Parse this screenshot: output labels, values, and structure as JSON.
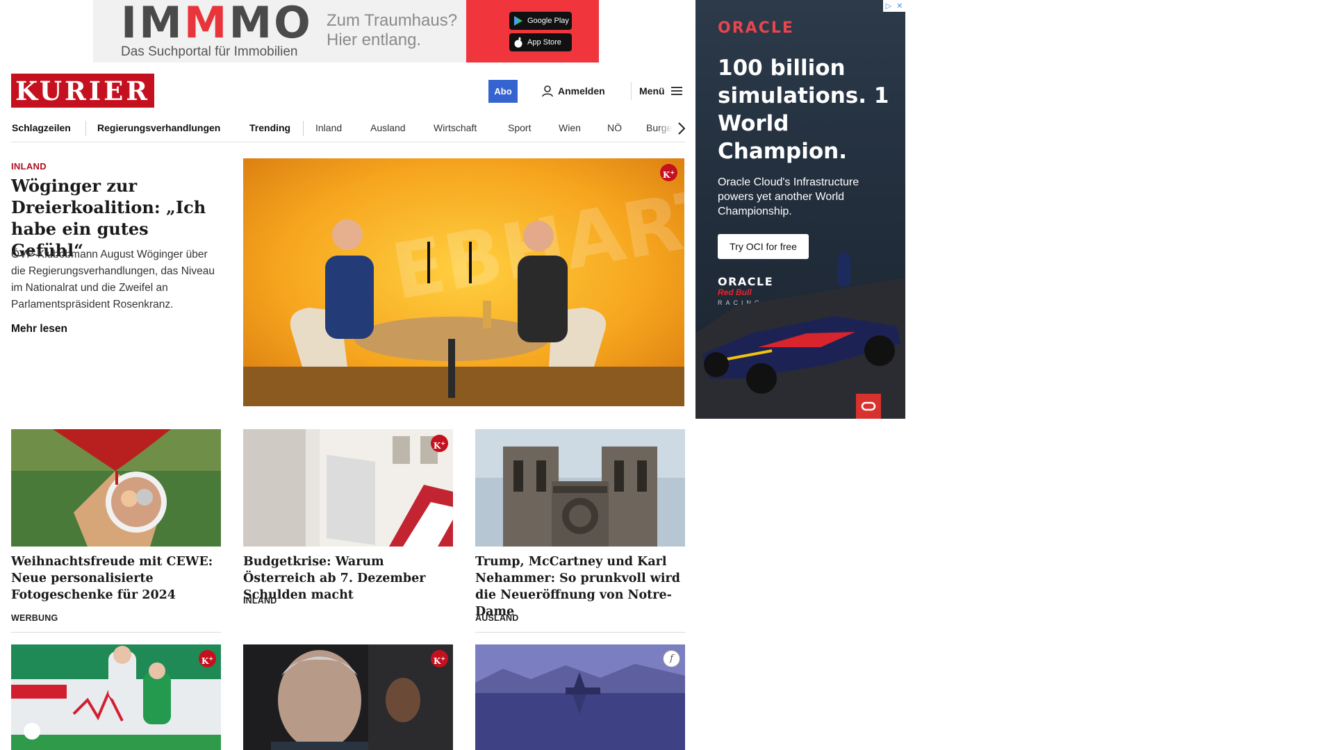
{
  "top_ad": {
    "brand_a": "IM",
    "brand_b": "M",
    "brand_c": "MO",
    "tagline": "Das Suchportal für Immobilien",
    "claim_line1": "Zum Traumhaus?",
    "claim_line2": "Hier entlang.",
    "google_play": "Google Play",
    "app_store": "App Store"
  },
  "header": {
    "logo": "KURIER",
    "abo": "Abo",
    "login": "Anmelden",
    "menu": "Menü"
  },
  "nav": {
    "items": [
      "Schlagzeilen",
      "Regierungsverhandlungen",
      "Trending",
      "Inland",
      "Ausland",
      "Wirtschaft",
      "Sport",
      "Wien",
      "NÖ",
      "Burgenl"
    ]
  },
  "lead": {
    "category": "INLAND",
    "title": "Wöginger zur Dreierko­alition: „Ich habe ein gu­tes Gefühl“",
    "teaser": "ÖVP-Klubobmann August Wöginger über die Regierungsverhandlungen, das Niveau im Nationalrat und die Zweifel an Parlamentspräsident Rosenkranz.",
    "more": "Mehr lesen",
    "image_watermark": "EBHART"
  },
  "cards_row1": [
    {
      "title": "Weihnachtsfreude mit CEWE: Neue personalisierte Fotogeschenke für 2024",
      "category": "WERBUNG"
    },
    {
      "title": "Budgetkrise: Warum Österreich ab 7. Dezember Schulden macht",
      "category": "INLAND"
    },
    {
      "title": "Trump, McCartney und Karl Ne­hammer: So prunkvoll wird die Neueröffnung von Notre-Dame",
      "category": "AUSLAND"
    }
  ],
  "badges": {
    "kplus": "K",
    "kplus_sup": "+",
    "f": "f"
  },
  "side_ad": {
    "brand": "ORACLE",
    "headline": "100 billion simulations. 1 World Champion.",
    "body": "Oracle Cloud's Infrastructure powers yet another World Championship.",
    "cta": "Try OCI for free",
    "small_brand": "ORACLE",
    "partner": "Red Bull",
    "racing": "RACING"
  },
  "colors": {
    "kurier_red": "#c5101f",
    "abo_blue": "#3564d1",
    "immo_red": "#f0353d",
    "oracle_red": "#e8454d"
  }
}
